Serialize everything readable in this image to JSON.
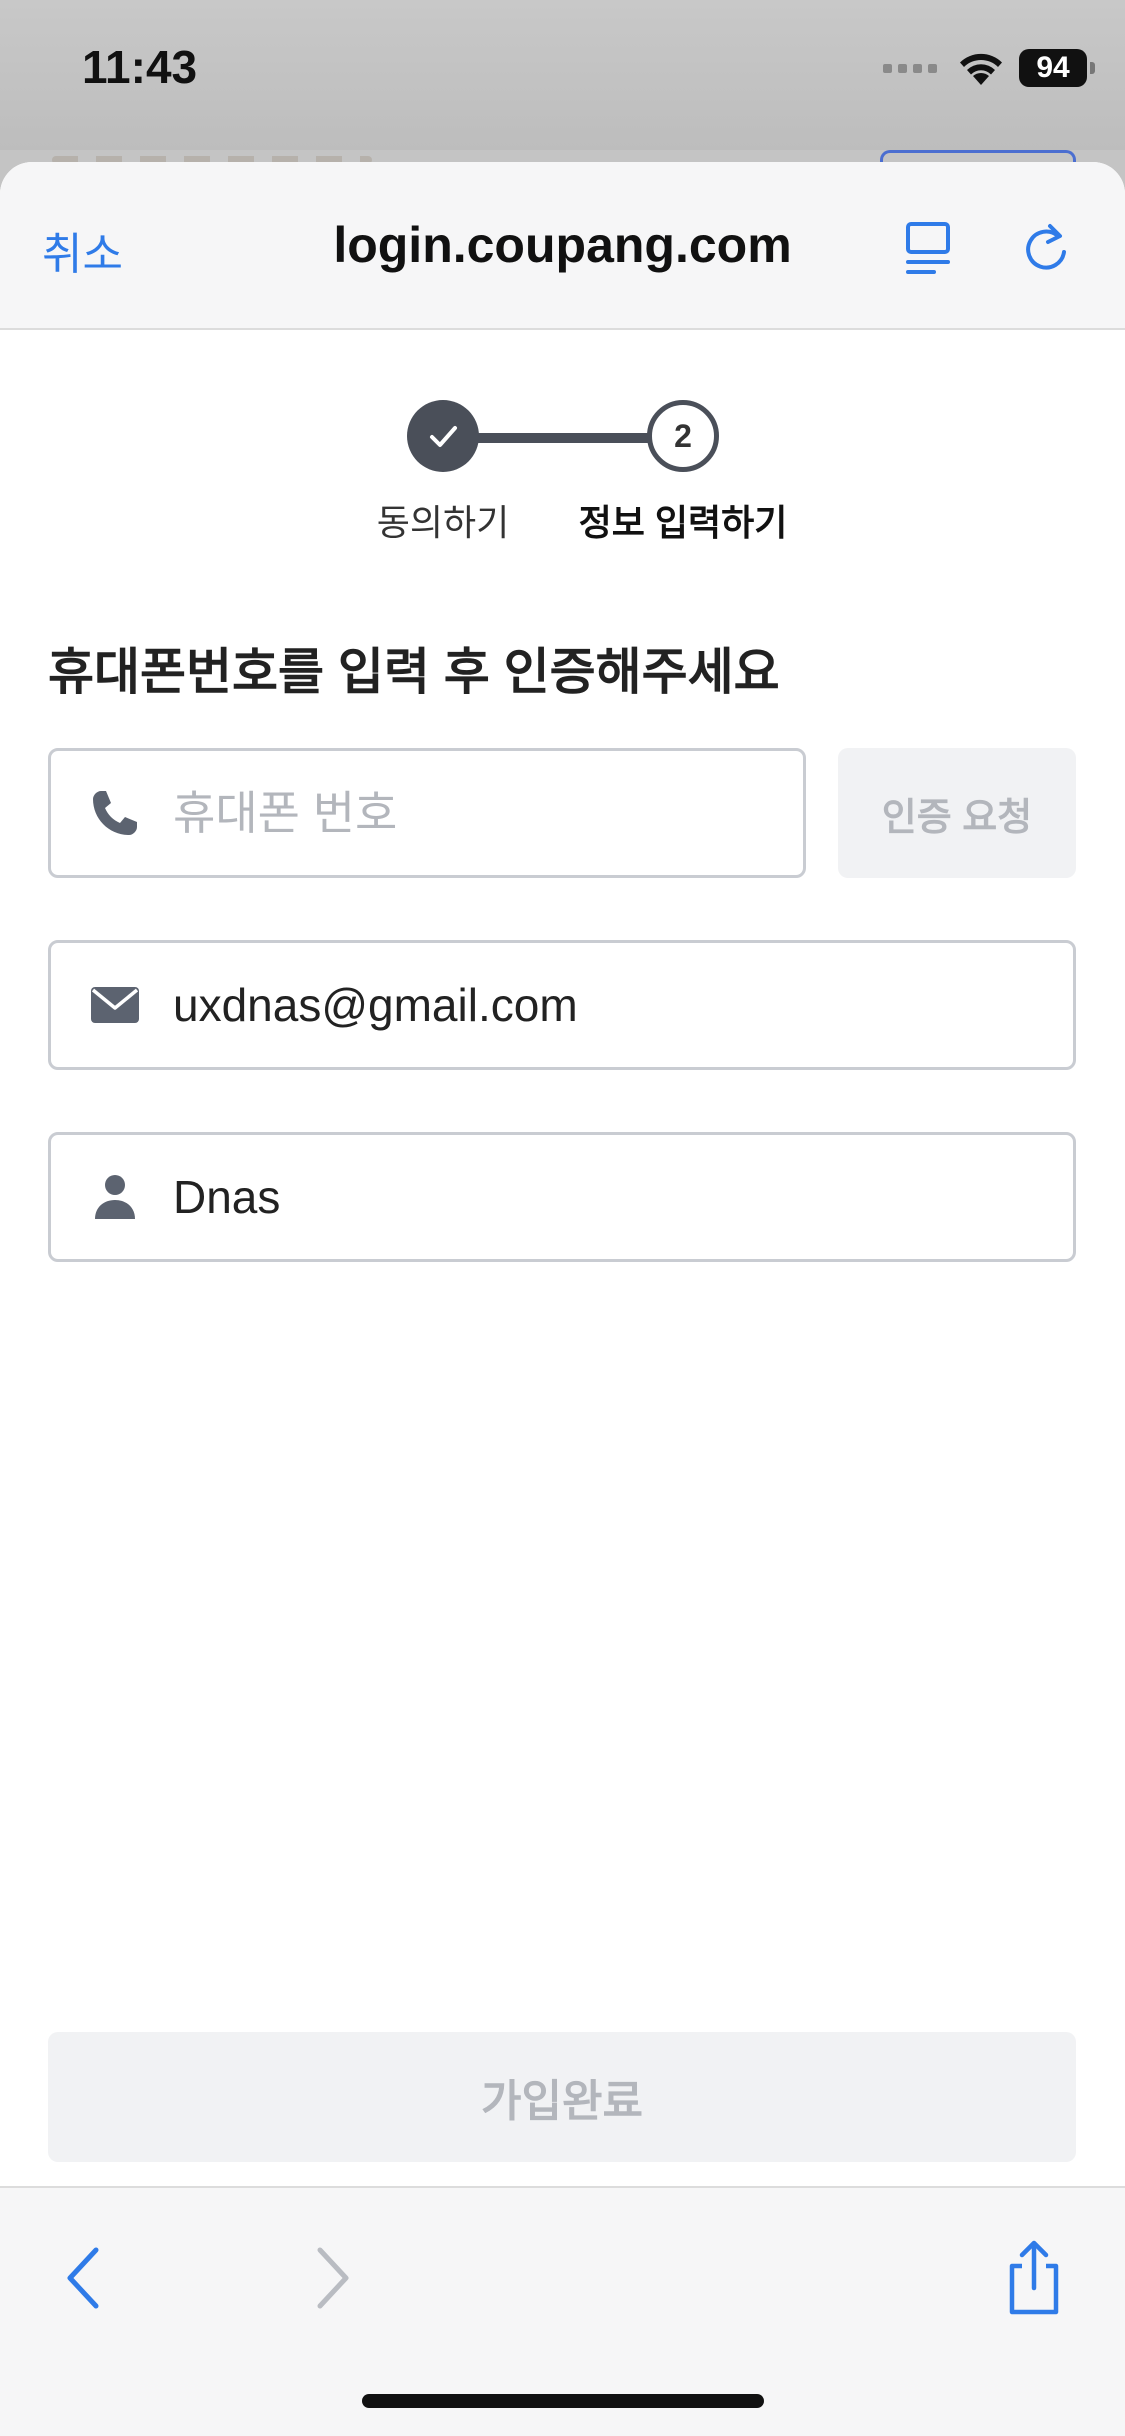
{
  "status_bar": {
    "time": "11:43",
    "battery": "94"
  },
  "browser": {
    "cancel_label": "취소",
    "url": "login.coupang.com",
    "reader_icon": "reader-icon",
    "reload_icon": "reload-icon"
  },
  "stepper": {
    "steps": [
      {
        "label": "동의하기",
        "state": "done"
      },
      {
        "number": "2",
        "label": "정보 입력하기",
        "state": "current"
      }
    ]
  },
  "form": {
    "title": "휴대폰번호를 입력 후 인증해주세요",
    "phone": {
      "value": "",
      "placeholder": "휴대폰 번호",
      "icon": "phone-icon"
    },
    "verify_label": "인증 요청",
    "email": {
      "value": "uxdnas@gmail.com",
      "icon": "mail-icon"
    },
    "name": {
      "value": "Dnas",
      "icon": "person-icon"
    },
    "submit_label": "가입완료"
  },
  "toolbar": {
    "back_icon": "back-icon",
    "forward_icon": "forward-icon",
    "share_icon": "share-icon"
  },
  "colors": {
    "accent": "#2f7be8",
    "step": "#4a4f59",
    "disabled_text": "#b3b6bc",
    "disabled_bg": "#f1f2f4"
  }
}
